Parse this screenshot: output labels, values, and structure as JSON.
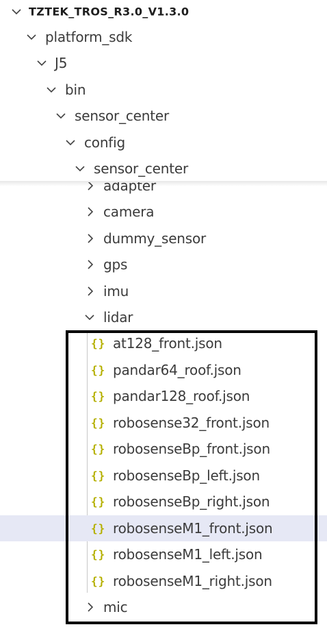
{
  "explorer": {
    "root": {
      "label": "TZTEK_TROS_R3.0_V1.3.0",
      "expanded": true
    },
    "sticky_folders": [
      {
        "label": "platform_sdk",
        "expanded": true
      },
      {
        "label": "J5",
        "expanded": true
      },
      {
        "label": "bin",
        "expanded": true
      },
      {
        "label": "sensor_center",
        "expanded": true
      },
      {
        "label": "config",
        "expanded": true
      },
      {
        "label": "sensor_center",
        "expanded": true
      }
    ],
    "folders": [
      {
        "label": "adapter",
        "expanded": false
      },
      {
        "label": "camera",
        "expanded": false
      },
      {
        "label": "dummy_sensor",
        "expanded": false
      },
      {
        "label": "gps",
        "expanded": false
      },
      {
        "label": "imu",
        "expanded": false
      },
      {
        "label": "lidar",
        "expanded": true
      }
    ],
    "file_icon_glyph": "{}",
    "lidar_files": [
      {
        "label": "at128_front.json"
      },
      {
        "label": "pandar64_roof.json"
      },
      {
        "label": "pandar128_roof.json"
      },
      {
        "label": "robosense32_front.json"
      },
      {
        "label": "robosenseBp_front.json"
      },
      {
        "label": "robosenseBp_left.json"
      },
      {
        "label": "robosenseBp_right.json"
      },
      {
        "label": "robosenseM1_front.json",
        "selected": true
      },
      {
        "label": "robosenseM1_left.json"
      },
      {
        "label": "robosenseM1_right.json"
      }
    ],
    "after_folder": {
      "label": "mic",
      "expanded": false
    },
    "colors": {
      "json_icon": "#b5b000",
      "selection": "#e6e8f5",
      "annotation_box": "#000000"
    }
  }
}
